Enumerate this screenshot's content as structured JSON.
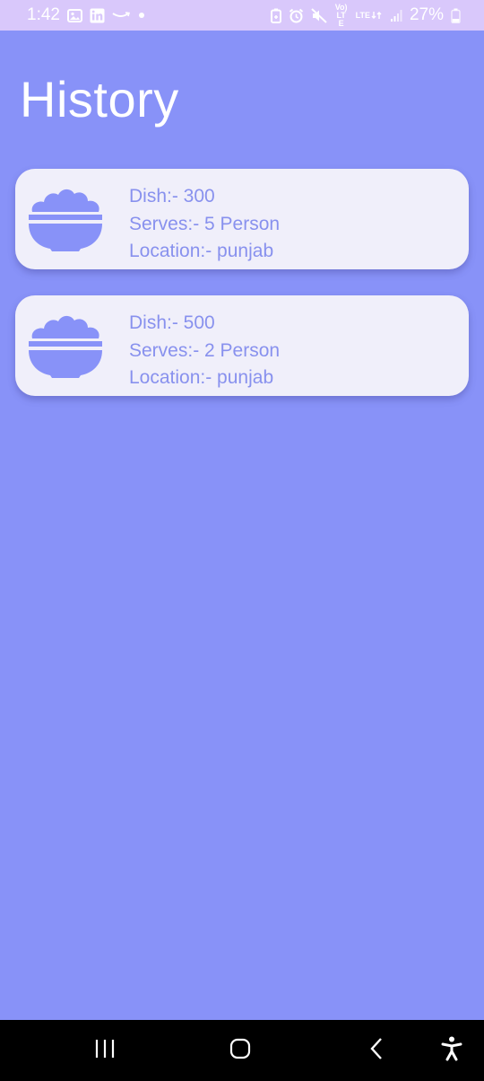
{
  "status_bar": {
    "time": "1:42",
    "battery": "27%",
    "icons": [
      "image-icon",
      "linkedin-icon",
      "amazon-icon",
      "dot-icon",
      "battery-saver-icon",
      "alarm-icon",
      "mute-icon",
      "volte-icon",
      "lte-icon",
      "signal-icon",
      "battery-icon"
    ],
    "volte_label": "Vo) LTE",
    "lte_label": "LTE"
  },
  "page": {
    "title": "History"
  },
  "history": [
    {
      "icon": "bowl-icon",
      "dish": "Dish:- 300",
      "serves": "Serves:- 5 Person",
      "location": "Location:- punjab"
    },
    {
      "icon": "bowl-icon",
      "dish": "Dish:- 500",
      "serves": "Serves:- 2 Person",
      "location": "Location:- punjab"
    }
  ],
  "nav_bar": {
    "buttons": [
      "recents-icon",
      "home-icon",
      "back-icon",
      "accessibility-icon"
    ]
  },
  "colors": {
    "background": "#8892f8",
    "status_bar": "#d9c8fb",
    "card": "#f0effa",
    "card_text": "#8891ee",
    "title": "#ffffff"
  }
}
